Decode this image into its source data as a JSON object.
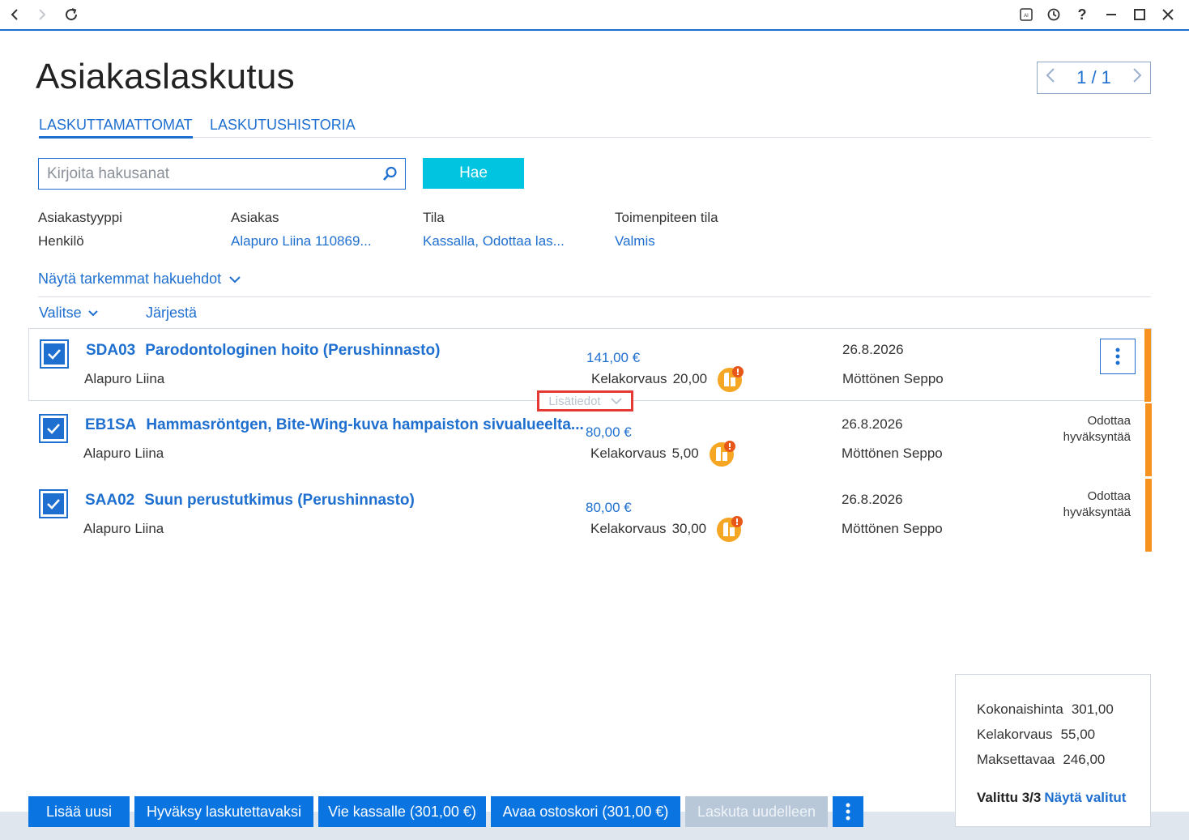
{
  "window": {
    "controls": [
      "back",
      "forward",
      "refresh",
      "ai",
      "history",
      "help",
      "minimize",
      "maximize",
      "close"
    ],
    "help_label": "?"
  },
  "page": {
    "title": "Asiakaslaskutus",
    "pager": "1 / 1"
  },
  "tabs": [
    {
      "label": "LASKUTTAMATTOMAT",
      "active": true
    },
    {
      "label": "LASKUTUSHISTORIA",
      "active": false
    }
  ],
  "search": {
    "placeholder": "Kirjoita hakusanat",
    "value": "",
    "button_label": "Hae"
  },
  "filters": [
    {
      "label": "Asiakastyyppi",
      "value": "Henkilö"
    },
    {
      "label": "Asiakas",
      "value": "Alapuro Liina 110869..."
    },
    {
      "label": "Tila",
      "value": "Kassalla, Odottaa las..."
    },
    {
      "label": "Toimenpiteen tila",
      "value": "Valmis"
    }
  ],
  "more_filters_label": "Näytä tarkemmat hakuehdot",
  "list_toolbar": {
    "select_label": "Valitse",
    "sort_label": "Järjestä"
  },
  "rows": [
    {
      "code": "SDA03",
      "name": "Parodontologinen hoito (Perushinnasto)",
      "customer": "Alapuro Liina",
      "price": "141,00 €",
      "kela_label": "Kelakorvaus",
      "kela_amount": "20,00",
      "date": "26.8.2026",
      "handler": "Möttönen Seppo",
      "status": "",
      "checked": true
    },
    {
      "code": "EB1SA",
      "name": "Hammasröntgen, Bite-Wing-kuva hampaiston sivualueelta...",
      "customer": "Alapuro Liina",
      "price": "80,00 €",
      "kela_label": "Kelakorvaus",
      "kela_amount": "5,00",
      "date": "26.8.2026",
      "handler": "Möttönen Seppo",
      "status": "Odottaa hyväksyntää",
      "checked": true
    },
    {
      "code": "SAA02",
      "name": "Suun perustutkimus (Perushinnasto)",
      "customer": "Alapuro Liina",
      "price": "80,00 €",
      "kela_label": "Kelakorvaus",
      "kela_amount": "30,00",
      "date": "26.8.2026",
      "handler": "Möttönen Seppo",
      "status": "Odottaa hyväksyntää",
      "checked": true
    }
  ],
  "details_toggle_label": "Lisätiedot",
  "summary": {
    "total_label": "Kokonaishinta",
    "total_value": "301,00",
    "kela_label": "Kelakorvaus",
    "kela_value": "55,00",
    "payable_label": "Maksettavaa",
    "payable_value": "246,00",
    "selected_label": "Valittu 3/3",
    "show_selected_label": "Näytä valitut"
  },
  "actions": {
    "add_new": "Lisää uusi",
    "approve": "Hyväksy laskutettavaksi",
    "to_checkout": "Vie kassalle (301,00 €)",
    "open_cart": "Avaa ostoskori (301,00 €)",
    "rebill": "Laskuta uudelleen"
  },
  "colors": {
    "accent": "#1e6fd0",
    "search_button": "#00c4e0",
    "status_bar": "#f7921e",
    "kela_icon": "#f5a623",
    "highlight": "#e53935"
  }
}
